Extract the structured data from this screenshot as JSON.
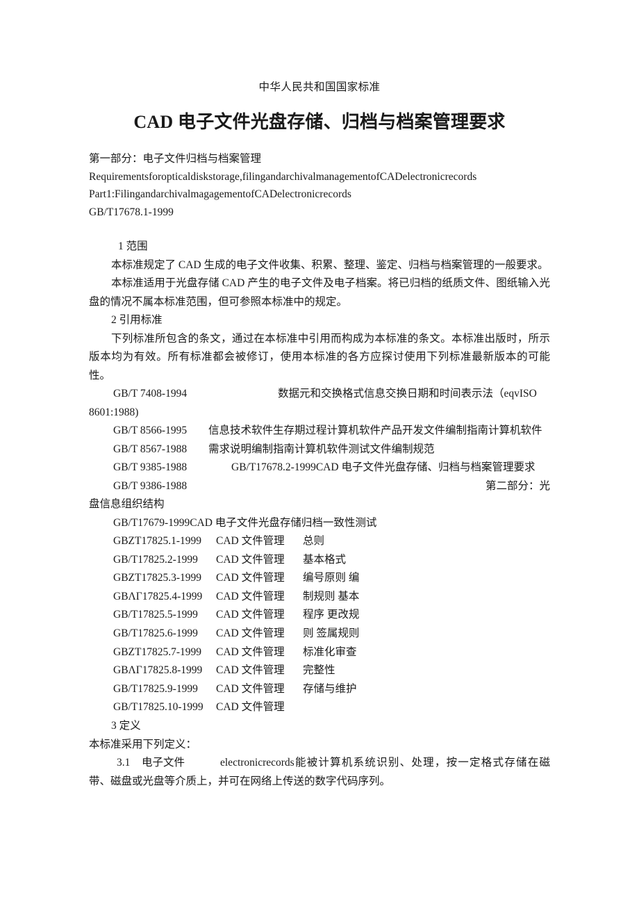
{
  "document": {
    "organization": "中华人民共和国国家标准",
    "title": "CAD 电子文件光盘存储、归档与档案管理要求",
    "part_line": "第一部分：电子文件归档与档案管理",
    "english_title": "Requirementsforopticaldiskstorage,filingandarchivalmanagementofCADelectronicrecords",
    "english_part": "Part1:FilingandarchivalmagagementofCADelectronicrecords",
    "standard_number": "GB/T17678.1-1999"
  },
  "sections": {
    "scope": {
      "heading": "1 范围",
      "paragraph_1": "本标准规定了 CAD 生成的电子文件收集、积累、整理、鉴定、归档与档案管理的一般要求。",
      "paragraph_2": "本标准适用于光盘存储 CAD 产生的电子文件及电子档案。将已归档的纸质文件、图纸输入光盘的情况不属本标准范围，但可参照本标准中的规定。"
    },
    "references": {
      "heading": "2 引用标准",
      "paragraph": "下列标准所包含的条文，通过在本标准中引用而构成为本标准的条文。本标准出版时，所示版本均为有效。所有标准都会被修订，使用本标准的各方应探讨使用下列标准最新版本的可能性。",
      "entries": [
        {
          "code": "GB/T 7408-1994",
          "text": "数据元和交换格式信息交换日期和时间表示法（eqvISO",
          "continuation": "8601:1988)"
        },
        {
          "code": "GB/T 8566-1995",
          "text": "信息技术软件生存期过程计算机软件产品开发文件编制指南计算机软件"
        },
        {
          "code": "GB/T 8567-1988",
          "text": "需求说明编制指南计算机软件测试文件编制规范"
        },
        {
          "code": "GB/T 9385-1988",
          "text": "GB/T17678.2-1999CAD 电子文件光盘存储、归档与档案管理要求"
        },
        {
          "code": "GB/T 9386-1988",
          "text": "第二部分：光",
          "continuation": "盘信息组织结构"
        }
      ],
      "standalone_entry": "GB/T17679-1999CAD 电子文件光盘存储归档一致性测试",
      "cad_management": [
        {
          "code": "GBZT17825.1-1999",
          "name": "CAD 文件管理",
          "subject": "总则"
        },
        {
          "code": "GB/T17825.2-1999",
          "name": "CAD 文件管理",
          "subject": "基本格式"
        },
        {
          "code": "GBZT17825.3-1999",
          "name": "CAD 文件管理",
          "subject": "编号原则 编"
        },
        {
          "code": "GBΛΓ17825.4-1999",
          "name": "CAD 文件管理",
          "subject": "制规则 基本"
        },
        {
          "code": "GB/T17825.5-1999",
          "name": "CAD 文件管理",
          "subject": "程序 更改规"
        },
        {
          "code": "GB/T17825.6-1999",
          "name": "CAD 文件管理",
          "subject": "则 签属规则"
        },
        {
          "code": "GBZT17825.7-1999",
          "name": "CAD 文件管理",
          "subject": "标准化审查"
        },
        {
          "code": "GBΛΓ17825.8-1999",
          "name": "CAD 文件管理",
          "subject": "完整性"
        },
        {
          "code": "GB/T17825.9-1999",
          "name": "CAD 文件管理",
          "subject": "存储与维护"
        },
        {
          "code": "GB/T17825.10-1999",
          "name": "CAD 文件管理",
          "subject": ""
        }
      ]
    },
    "definitions": {
      "heading": "3 定义",
      "intro": "本标准采用下列定义：",
      "entries": [
        {
          "number": "3.1",
          "term": "电子文件",
          "english": "electronicrecords",
          "body": "能被计算机系统识别、处理，按一定格式存储在磁带、磁盘或光盘等介质上，并可在网络上传送的数字代码序列。"
        }
      ]
    }
  }
}
